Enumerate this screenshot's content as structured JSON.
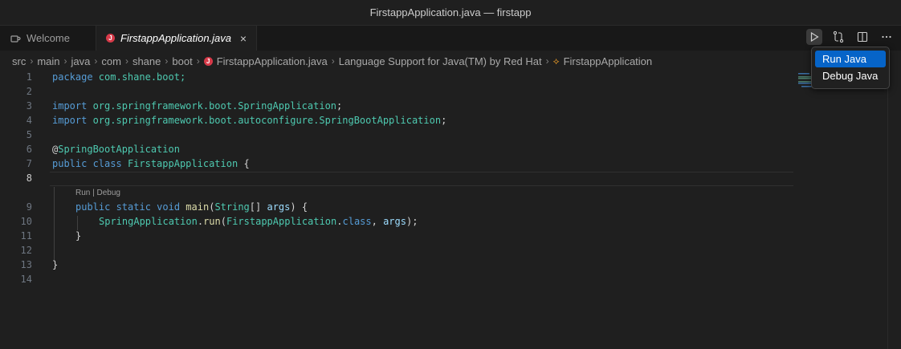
{
  "window": {
    "title": "FirstappApplication.java — firstapp"
  },
  "tabs": [
    {
      "label": "Welcome",
      "icon": "welcome-icon"
    },
    {
      "label": "FirstappApplication.java",
      "icon": "java-icon",
      "close": "×"
    }
  ],
  "breadcrumb": [
    "src",
    "main",
    "java",
    "com",
    "shane",
    "boot",
    "FirstappApplication.java",
    "Language Support for Java(TM) by Red Hat",
    "FirstappApplication"
  ],
  "editor": {
    "line_numbers": [
      "1",
      "2",
      "3",
      "4",
      "5",
      "6",
      "7",
      "8",
      "9",
      "10",
      "11",
      "12",
      "13",
      "14"
    ],
    "codelens": "Run | Debug",
    "lines": {
      "l1": {
        "a": "package",
        "b": " com.shane.boot;"
      },
      "l3": {
        "a": "import",
        "b": " org.springframework.boot.",
        "c": "SpringApplication",
        "d": ";"
      },
      "l4": {
        "a": "import",
        "b": " org.springframework.boot.autoconfigure.",
        "c": "SpringBootApplication",
        "d": ";"
      },
      "l6": {
        "a": "@",
        "b": "SpringBootApplication"
      },
      "l7": {
        "a": "public",
        "b": " class ",
        "c": "FirstappApplication",
        "d": " {"
      },
      "l9": {
        "a": "public",
        "b": " static",
        "c": " void ",
        "d": "main",
        "e": "(",
        "f": "String",
        "g": "[] ",
        "h": "args",
        "i": ") {"
      },
      "l10": {
        "a": "SpringApplication",
        "b": ".",
        "c": "run",
        "d": "(",
        "e": "FirstappApplication",
        "f": ".",
        "g": "class",
        "h": ", ",
        "i": "args",
        "j": ");"
      },
      "l11": {
        "a": "}"
      },
      "l13": {
        "a": "}"
      }
    }
  },
  "run_menu": {
    "items": [
      "Run Java",
      "Debug Java"
    ]
  }
}
